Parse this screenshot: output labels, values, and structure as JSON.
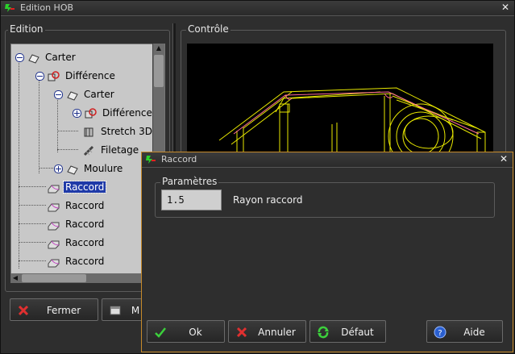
{
  "main_window": {
    "title": "Edition HOB",
    "close_glyph": "✕",
    "edition_group_label": "Edition",
    "controle_group_label": "Contrôle"
  },
  "tree": {
    "items": [
      {
        "label": "Carter",
        "icon": "part-icon",
        "expander": "minus"
      },
      {
        "label": "Différence",
        "icon": "difference-icon",
        "expander": "minus"
      },
      {
        "label": "Carter",
        "icon": "part-icon",
        "expander": "minus"
      },
      {
        "label": "Différence",
        "icon": "difference-icon",
        "expander": "plus"
      },
      {
        "label": "Stretch 3D",
        "icon": "stretch-icon",
        "expander": null
      },
      {
        "label": "Filetage",
        "icon": "thread-icon",
        "expander": null
      },
      {
        "label": "Moulure",
        "icon": "part-icon",
        "expander": "plus"
      },
      {
        "label": "Raccord",
        "icon": "fillet-icon",
        "expander": null,
        "selected": true
      },
      {
        "label": "Raccord",
        "icon": "fillet-icon",
        "expander": null
      },
      {
        "label": "Raccord",
        "icon": "fillet-icon",
        "expander": null
      },
      {
        "label": "Raccord",
        "icon": "fillet-icon",
        "expander": null
      },
      {
        "label": "Raccord",
        "icon": "fillet-icon",
        "expander": null
      }
    ]
  },
  "bottom_buttons": {
    "fermer": {
      "label": "Fermer",
      "icon": "close-x-icon"
    },
    "m": {
      "label": "M",
      "icon": "window-icon"
    }
  },
  "dialog": {
    "title": "Raccord",
    "close_glyph": "✕",
    "params_group_label": "Paramètres",
    "rayon_value": "1.5",
    "rayon_label": "Rayon raccord",
    "buttons": {
      "ok": {
        "label": "Ok",
        "icon": "checkmark-icon"
      },
      "annuler": {
        "label": "Annuler",
        "icon": "cancel-x-icon"
      },
      "defaut": {
        "label": "Défaut",
        "icon": "reset-icon"
      },
      "aide": {
        "label": "Aide",
        "icon": "help-icon"
      }
    }
  },
  "colors": {
    "accent_border": "#c68a2a",
    "selection": "#1f3aa8",
    "wire_yellow": "#e8e800",
    "wire_pink": "#ff6a9a"
  }
}
